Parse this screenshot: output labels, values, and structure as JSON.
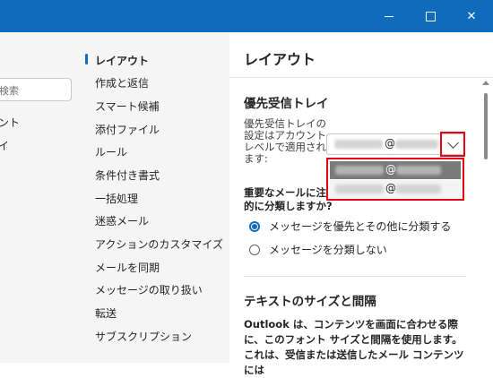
{
  "window": {
    "minimize_icon": "minimize-icon",
    "maximize_icon": "maximize-icon",
    "close_icon": "close-icon",
    "close_glyph": "✕",
    "accent_color": "#0f6cbd"
  },
  "left_pane": {
    "search_placeholder": "検索",
    "items": [
      "ント",
      "イ"
    ]
  },
  "nav": {
    "items": [
      {
        "label": "レイアウト",
        "selected": true
      },
      {
        "label": "作成と返信"
      },
      {
        "label": "スマート候補"
      },
      {
        "label": "添付ファイル"
      },
      {
        "label": "ルール"
      },
      {
        "label": "条件付き書式"
      },
      {
        "label": "一括処理"
      },
      {
        "label": "迷惑メール"
      },
      {
        "label": "アクションのカスタマイズ"
      },
      {
        "label": "メールを同期"
      },
      {
        "label": "メッセージの取り扱い"
      },
      {
        "label": "転送"
      },
      {
        "label": "サブスクリプション"
      }
    ]
  },
  "content": {
    "title": "レイアウト",
    "focused_inbox": {
      "heading": "優先受信トレイ",
      "account_label": "優先受信トレイの設定はアカウントレベルで適用されます:",
      "selected_account_at": "@",
      "dropdown_icon": "chevron-down-icon",
      "options_at": [
        "@",
        "@"
      ],
      "question": "重要なメールに注",
      "question_tail": "的に分類しますか?",
      "radio_options": [
        {
          "label": "メッセージを優先とその他に分類する",
          "checked": true
        },
        {
          "label": "メッセージを分類しない",
          "checked": false
        }
      ]
    },
    "text_size": {
      "heading": "テキストのサイズと間隔",
      "description": "Outlook は、コンテンツを画面に合わせる際に、このフォント サイズと間隔を使用します。これは、受信または送信したメール コンテンツには"
    }
  }
}
